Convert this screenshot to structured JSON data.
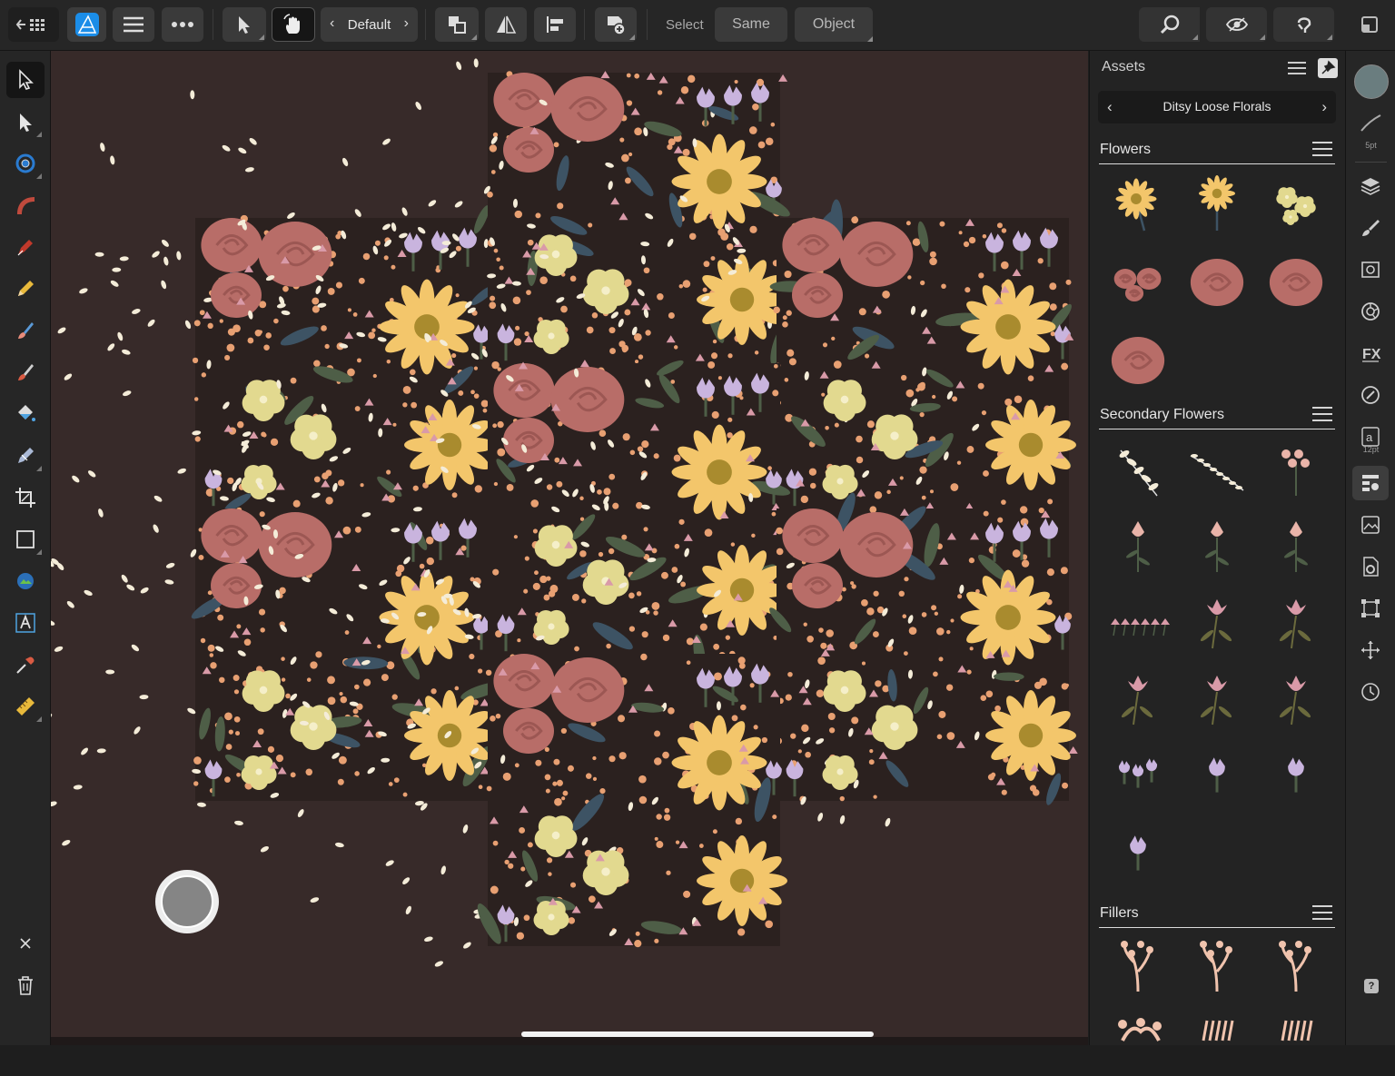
{
  "toolbar": {
    "persona_default_label": "Default",
    "select_label": "Select",
    "same_label": "Same",
    "object_label": "Object"
  },
  "assets_panel": {
    "title": "Assets",
    "category": "Ditsy Loose Florals",
    "sections": [
      {
        "label": "Flowers"
      },
      {
        "label": "Secondary Flowers"
      },
      {
        "label": "Fillers"
      }
    ]
  },
  "right_studio": {
    "brush_size_label": "5pt",
    "text_size_label": "12pt"
  },
  "colors": {
    "canvas_bg": "#372a29",
    "rose": "#b86d68",
    "lavender": "#c9b4de",
    "yellow": "#f3c66b",
    "pale_yellow": "#e2d98f",
    "leaf": "#4e5e47",
    "blue_leaf": "#3d5364",
    "peach": "#e8a072",
    "primary_color_swatch": "#6a7d7f"
  },
  "icons": [
    "back-to-gallery-icon",
    "affinity-designer-logo",
    "menu-icon",
    "more-icon",
    "move-tool-icon",
    "touch-modifier-icon",
    "arrange-icon",
    "flip-icon",
    "align-icon",
    "insert-icon",
    "zoom-icon",
    "view-mode-icon",
    "snapping-icon",
    "help-icon",
    "close-icon",
    "trash-icon"
  ]
}
